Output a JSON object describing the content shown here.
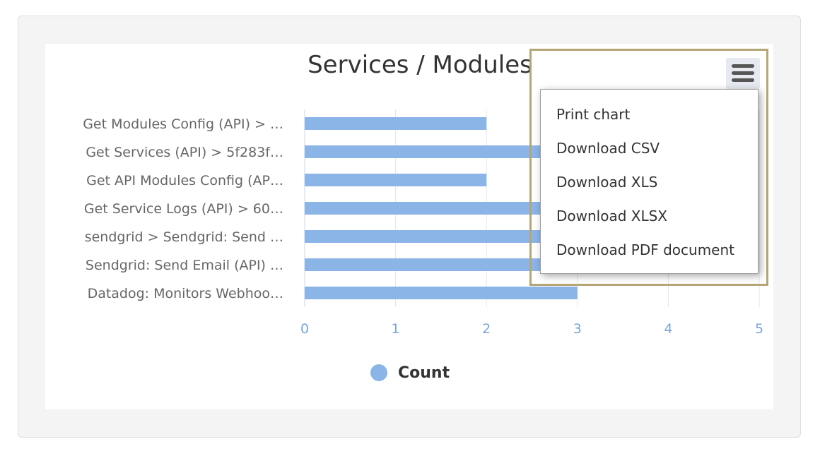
{
  "colors": {
    "bar": "#8bb4e7",
    "grid": "#e6e6e6",
    "axis_line": "#ccd6eb",
    "x_tick_text": "#7ba6d4",
    "category_text": "#666666",
    "highlight": "#b5a675"
  },
  "chart": {
    "title": "Services / Modules",
    "legend_label": "Count",
    "menu_icon": "hamburger-menu-icon"
  },
  "chart_data": {
    "type": "bar",
    "orientation": "horizontal",
    "title": "Services / Modules",
    "xlabel": "",
    "ylabel": "",
    "categories": [
      "Get Modules Config (API) > …",
      "Get Services (API) > 5f283f…",
      "Get API Modules Config (AP…",
      "Get Service Logs (API) > 60…",
      "sendgrid > Sendgrid: Send …",
      "Sendgrid: Send Email (API) …",
      "Datadog: Monitors Webhoo…"
    ],
    "series": [
      {
        "name": "Count",
        "values": [
          2,
          3,
          2,
          3,
          3,
          3,
          3
        ]
      }
    ],
    "xlim": [
      0,
      5
    ],
    "x_ticks": [
      "0",
      "1",
      "2",
      "3",
      "4",
      "5"
    ],
    "grid": true,
    "legend": "bottom-center"
  },
  "export_menu": {
    "items": [
      {
        "label": "Print chart"
      },
      {
        "label": "Download CSV"
      },
      {
        "label": "Download XLS"
      },
      {
        "label": "Download XLSX"
      },
      {
        "label": "Download PDF document"
      }
    ]
  }
}
